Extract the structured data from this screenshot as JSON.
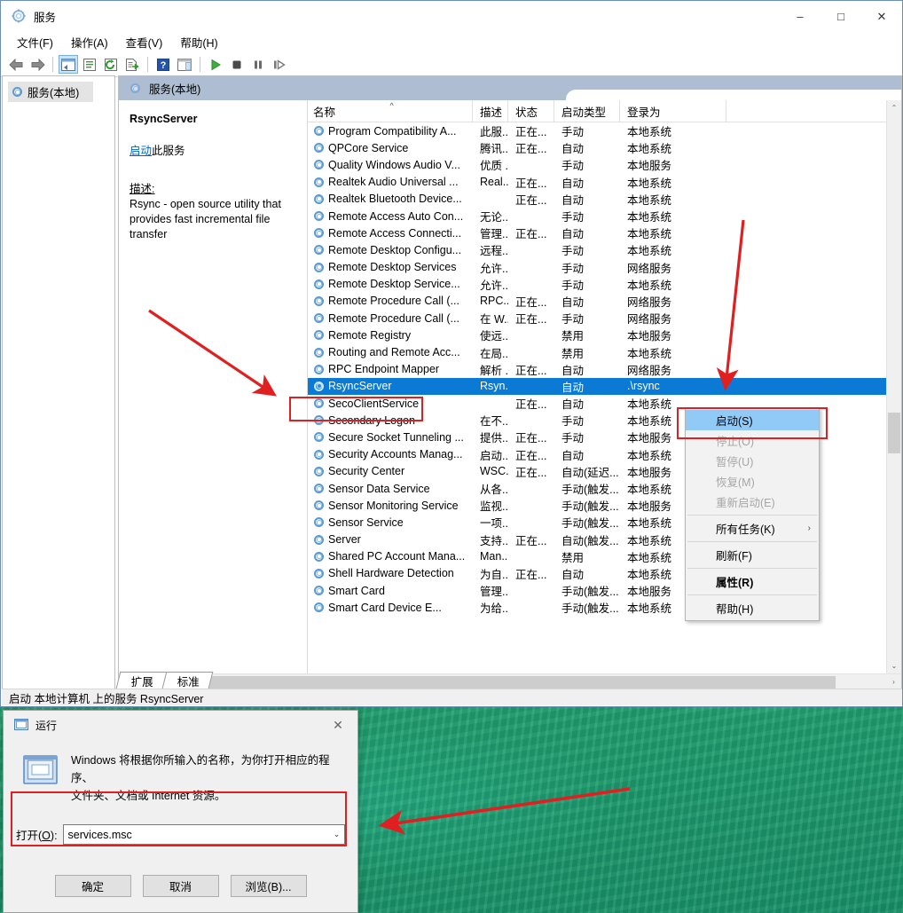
{
  "window": {
    "title": "服务",
    "title_icon": "services-gear-icon",
    "controls": {
      "minimize": "–",
      "maximize": "□",
      "close": "✕"
    }
  },
  "menubar": [
    "文件(F)",
    "操作(A)",
    "查看(V)",
    "帮助(H)"
  ],
  "toolbar": [
    {
      "name": "back-icon",
      "glyph": "⬅"
    },
    {
      "name": "forward-icon",
      "glyph": "➡"
    },
    {
      "sep": true
    },
    {
      "name": "show-hide-console-tree-icon",
      "glyph": "▤",
      "selected": true
    },
    {
      "sep": false
    },
    {
      "name": "properties-icon",
      "glyph": "▤"
    },
    {
      "name": "refresh-icon",
      "glyph": "⟳"
    },
    {
      "name": "export-list-icon",
      "glyph": "⇥"
    },
    {
      "sep": true
    },
    {
      "name": "help-icon",
      "glyph": "?"
    },
    {
      "name": "show-hide-action-pane-icon",
      "glyph": "▥"
    },
    {
      "sep": true
    },
    {
      "name": "start-service-icon",
      "glyph": "▶"
    },
    {
      "name": "stop-service-icon",
      "glyph": "■"
    },
    {
      "name": "pause-service-icon",
      "glyph": "❚❚"
    },
    {
      "name": "restart-service-icon",
      "glyph": "❚▶"
    }
  ],
  "tree": {
    "root_label": "服务(本地)",
    "icon": "services-gear-icon"
  },
  "pane": {
    "header_title": "服务(本地)",
    "header_icon": "services-gear-icon"
  },
  "details": {
    "service_name": "RsyncServer",
    "action_link": "启动",
    "action_link_suffix": "此服务",
    "description_label": "描述:",
    "description_text": "Rsync - open source utility that provides fast incremental file transfer"
  },
  "columns": [
    {
      "key": "name",
      "label": "名称",
      "sorted": true,
      "sort_glyph": "^"
    },
    {
      "key": "desc",
      "label": "描述"
    },
    {
      "key": "state",
      "label": "状态"
    },
    {
      "key": "start",
      "label": "启动类型"
    },
    {
      "key": "logon",
      "label": "登录为"
    }
  ],
  "rows": [
    {
      "name": "Program Compatibility A...",
      "desc": "此服...",
      "state": "正在...",
      "start": "手动",
      "logon": "本地系统"
    },
    {
      "name": "QPCore Service",
      "desc": "腾讯...",
      "state": "正在...",
      "start": "自动",
      "logon": "本地系统"
    },
    {
      "name": "Quality Windows Audio V...",
      "desc": "优质 ...",
      "state": "",
      "start": "手动",
      "logon": "本地服务"
    },
    {
      "name": "Realtek Audio Universal ...",
      "desc": "Real...",
      "state": "正在...",
      "start": "自动",
      "logon": "本地系统"
    },
    {
      "name": "Realtek Bluetooth Device...",
      "desc": "",
      "state": "正在...",
      "start": "自动",
      "logon": "本地系统"
    },
    {
      "name": "Remote Access Auto Con...",
      "desc": "无论...",
      "state": "",
      "start": "手动",
      "logon": "本地系统"
    },
    {
      "name": "Remote Access Connecti...",
      "desc": "管理...",
      "state": "正在...",
      "start": "自动",
      "logon": "本地系统"
    },
    {
      "name": "Remote Desktop Configu...",
      "desc": "远程...",
      "state": "",
      "start": "手动",
      "logon": "本地系统"
    },
    {
      "name": "Remote Desktop Services",
      "desc": "允许...",
      "state": "",
      "start": "手动",
      "logon": "网络服务"
    },
    {
      "name": "Remote Desktop Service...",
      "desc": "允许...",
      "state": "",
      "start": "手动",
      "logon": "本地系统"
    },
    {
      "name": "Remote Procedure Call (...",
      "desc": "RPC...",
      "state": "正在...",
      "start": "自动",
      "logon": "网络服务"
    },
    {
      "name": "Remote Procedure Call (...",
      "desc": "在 W...",
      "state": "正在...",
      "start": "手动",
      "logon": "网络服务"
    },
    {
      "name": "Remote Registry",
      "desc": "使远...",
      "state": "",
      "start": "禁用",
      "logon": "本地服务"
    },
    {
      "name": "Routing and Remote Acc...",
      "desc": "在局...",
      "state": "",
      "start": "禁用",
      "logon": "本地系统"
    },
    {
      "name": "RPC Endpoint Mapper",
      "desc": "解析 ...",
      "state": "正在...",
      "start": "自动",
      "logon": "网络服务"
    },
    {
      "name": "RsyncServer",
      "desc": "Rsyn...",
      "state": "",
      "start": "自动",
      "logon": ".\\rsync",
      "selected": true
    },
    {
      "name": "SecoClientService",
      "desc": "",
      "state": "正在...",
      "start": "自动",
      "logon": "本地系统"
    },
    {
      "name": "Secondary Logon",
      "desc": "在不...",
      "state": "",
      "start": "手动",
      "logon": "本地系统"
    },
    {
      "name": "Secure Socket Tunneling ...",
      "desc": "提供...",
      "state": "正在...",
      "start": "手动",
      "logon": "本地服务"
    },
    {
      "name": "Security Accounts Manag...",
      "desc": "启动...",
      "state": "正在...",
      "start": "自动",
      "logon": "本地系统"
    },
    {
      "name": "Security Center",
      "desc": "WSC...",
      "state": "正在...",
      "start": "自动(延迟...",
      "logon": "本地服务"
    },
    {
      "name": "Sensor Data Service",
      "desc": "从各...",
      "state": "",
      "start": "手动(触发...",
      "logon": "本地系统"
    },
    {
      "name": "Sensor Monitoring Service",
      "desc": "监视...",
      "state": "",
      "start": "手动(触发...",
      "logon": "本地服务"
    },
    {
      "name": "Sensor Service",
      "desc": "一项...",
      "state": "",
      "start": "手动(触发...",
      "logon": "本地系统"
    },
    {
      "name": "Server",
      "desc": "支持...",
      "state": "正在...",
      "start": "自动(触发...",
      "logon": "本地系统"
    },
    {
      "name": "Shared PC Account Mana...",
      "desc": "Man...",
      "state": "",
      "start": "禁用",
      "logon": "本地系统"
    },
    {
      "name": "Shell Hardware Detection",
      "desc": "为自...",
      "state": "正在...",
      "start": "自动",
      "logon": "本地系统"
    },
    {
      "name": "Smart Card",
      "desc": "管理...",
      "state": "",
      "start": "手动(触发...",
      "logon": "本地服务"
    },
    {
      "name": "Smart Card Device E...",
      "desc": "为给...",
      "state": "",
      "start": "手动(触发...",
      "logon": "本地系统"
    }
  ],
  "context_menu": [
    {
      "label": "启动(S)",
      "state": "highlighted"
    },
    {
      "label": "停止(O)",
      "state": "disabled"
    },
    {
      "label": "暂停(U)",
      "state": "disabled"
    },
    {
      "label": "恢复(M)",
      "state": "disabled"
    },
    {
      "label": "重新启动(E)",
      "state": "disabled"
    },
    {
      "sep": true
    },
    {
      "label": "所有任务(K)",
      "state": "normal",
      "submenu": true,
      "arrow": "›"
    },
    {
      "sep": true
    },
    {
      "label": "刷新(F)",
      "state": "normal"
    },
    {
      "sep": true
    },
    {
      "label": "属性(R)",
      "state": "bold"
    },
    {
      "sep": true
    },
    {
      "label": "帮助(H)",
      "state": "normal"
    }
  ],
  "tabs": [
    {
      "label": "扩展",
      "active": false
    },
    {
      "label": "标准",
      "active": true
    }
  ],
  "statusbar": {
    "text": "启动 本地计算机 上的服务 RsyncServer"
  },
  "run_dialog": {
    "title": "运行",
    "title_icon": "run-window-icon",
    "close_glyph": "✕",
    "big_icon": "run-window-icon",
    "description_line1": "Windows 将根据你所输入的名称，为你打开相应的程序、",
    "description_line2": "文件夹、文档或 Internet 资源。",
    "open_label_prefix": "打开(",
    "open_label_key": "O",
    "open_label_suffix": "):",
    "open_value": "services.msc",
    "open_placeholder": "",
    "dropdown_glyph": "⌄",
    "buttons": [
      {
        "name": "ok",
        "label": "确定"
      },
      {
        "name": "cancel",
        "label": "取消"
      },
      {
        "name": "browse",
        "label": "浏览(B)..."
      }
    ]
  },
  "scroll": {
    "vertical_up": "⌃",
    "vertical_down": "⌄",
    "horizontal_left": "‹",
    "horizontal_right": "›"
  },
  "colors": {
    "selection_blue": "#0a7ad4",
    "menu_highlight": "#91c9f7",
    "pane_header": "#aebdd1",
    "annotation_red": "#e02020",
    "link_blue": "#0066cc"
  }
}
